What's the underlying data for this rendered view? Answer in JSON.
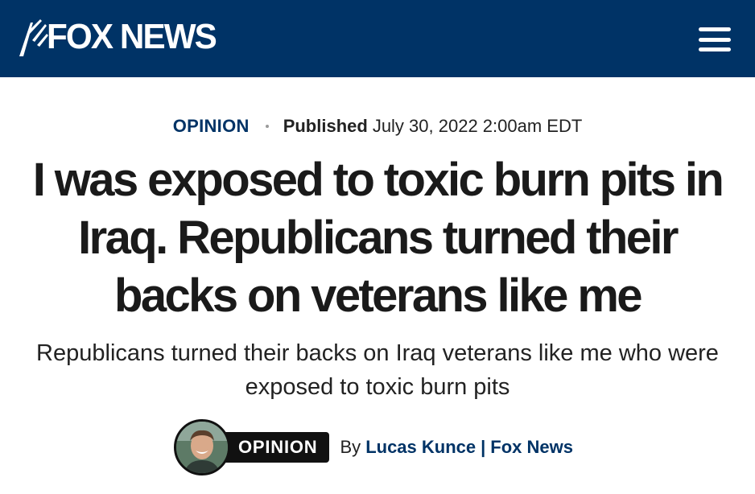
{
  "header": {
    "logo_text": "FOX NEWS",
    "logo_icon": "fox-searchlight-icon",
    "menu_icon": "hamburger-menu-icon",
    "bg_color": "#003366"
  },
  "article": {
    "category": "OPINION",
    "published_label": "Published",
    "published_date": "July 30, 2022 2:00am EDT",
    "headline": "I was exposed to toxic burn pits in Iraq. Republicans turned their backs on veterans like me",
    "subheadline": "Republicans turned their backs on Iraq veterans like me who were exposed to toxic burn pits"
  },
  "byline": {
    "badge": "OPINION",
    "by": "By",
    "author": "Lucas Kunce",
    "separator": "|",
    "outlet": "Fox News"
  }
}
